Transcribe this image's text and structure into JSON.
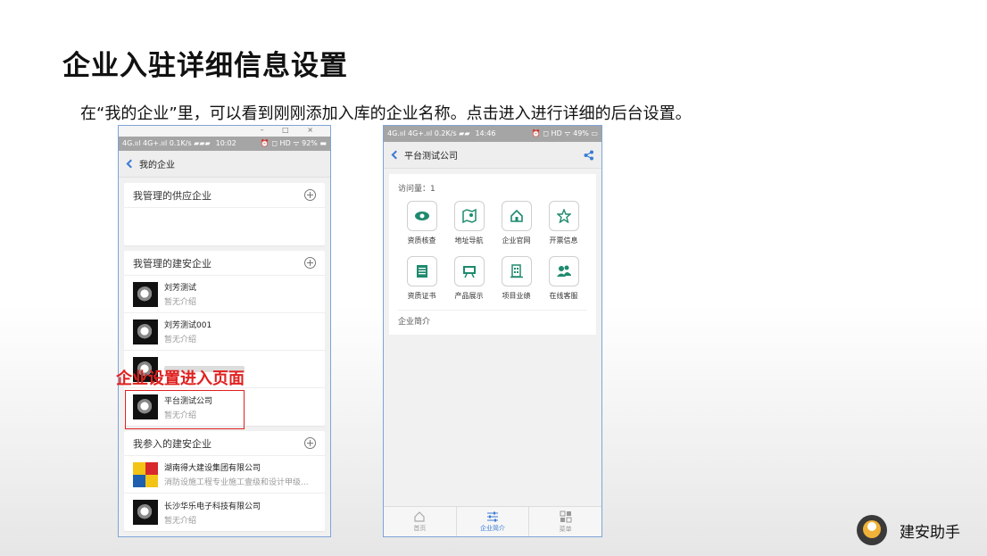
{
  "slide": {
    "title": "企业入驻详细信息设置",
    "description": "在“我的企业”里，可以看到刚刚添加入库的企业名称。点击进入进行详细的后台设置。",
    "annotation": "企业设置进入页面"
  },
  "phone1": {
    "window_controls": "– □ ×",
    "status_left": "4G.ııl 4G+.ııl 0.1K/s ▰▰▰",
    "status_time": "10:02",
    "status_right": "⏰ ◻ HD ᯤ 92% ▬",
    "nav_title": "我的企业",
    "sections": [
      {
        "title": "我管理的供应企业"
      },
      {
        "title": "我管理的建安企业",
        "companies": [
          {
            "name": "刘芳测试",
            "desc": "暂无介绍"
          },
          {
            "name": "刘芳测试001",
            "desc": "暂无介绍"
          },
          {
            "name": "",
            "desc": ""
          },
          {
            "name": "平台测试公司",
            "desc": "暂无介绍"
          }
        ]
      },
      {
        "title": "我参入的建安企业",
        "companies": [
          {
            "name": "湖南得大建设集团有限公司",
            "desc": "消防设施工程专业施工壹级和设计甲级..."
          },
          {
            "name": "长沙华乐电子科技有限公司",
            "desc": "暂无介绍"
          }
        ]
      }
    ]
  },
  "phone2": {
    "status_left": "4G.ııl 4G+.ııl 0.2K/s ▰▰",
    "status_time": "14:46",
    "status_right": "⏰ ◻ HD ᯤ 49% ▭",
    "nav_title": "平台测试公司",
    "visits": "访问量：1",
    "tiles": [
      {
        "label": "资质核查",
        "icon": "eye-icon"
      },
      {
        "label": "地址导航",
        "icon": "map-icon"
      },
      {
        "label": "企业官网",
        "icon": "home-icon"
      },
      {
        "label": "开票信息",
        "icon": "star-icon"
      },
      {
        "label": "资质证书",
        "icon": "certificate-icon"
      },
      {
        "label": "产品展示",
        "icon": "easel-icon"
      },
      {
        "label": "项目业绩",
        "icon": "building-icon"
      },
      {
        "label": "在线客服",
        "icon": "users-icon"
      }
    ],
    "intro": "企业简介",
    "tabs": [
      {
        "label": "首页",
        "icon": "home-icon",
        "active": false
      },
      {
        "label": "企业简介",
        "icon": "sliders-icon",
        "active": true
      },
      {
        "label": "菜单",
        "icon": "grid-icon",
        "active": false
      }
    ]
  },
  "brand": {
    "name": "建安助手"
  },
  "colors": {
    "accent": "#3a7bd5",
    "annotation": "#e0201f",
    "icon_green": "#1e8a6e"
  }
}
